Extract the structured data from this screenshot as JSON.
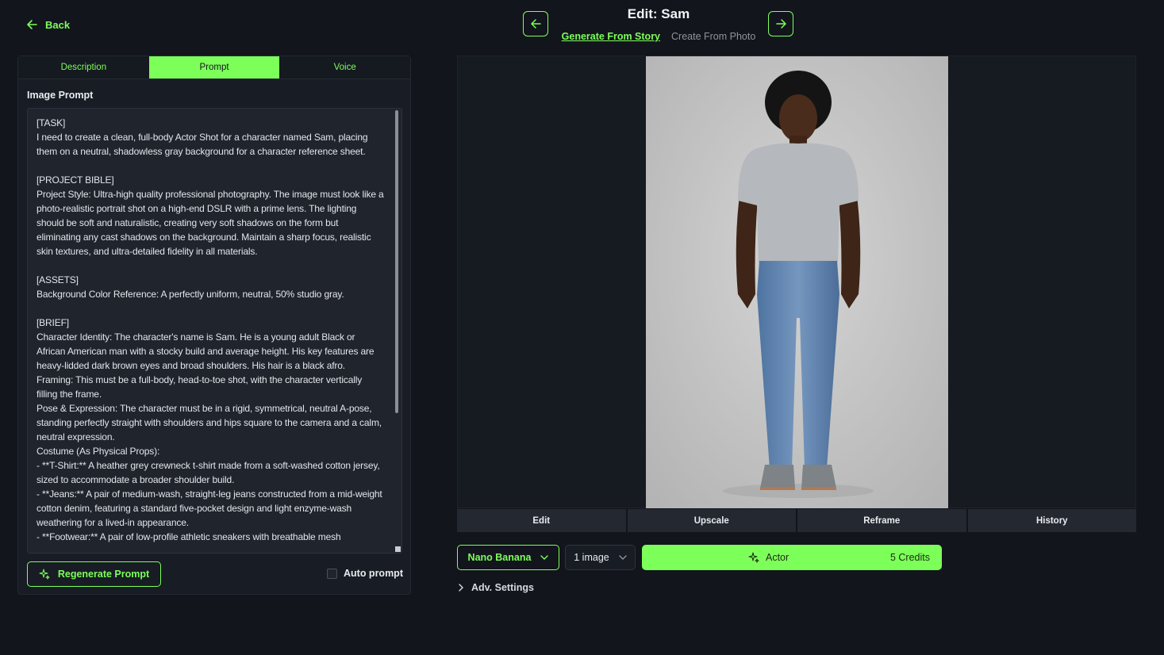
{
  "header": {
    "back_label": "Back",
    "title": "Edit: Sam",
    "mode_tabs": [
      {
        "label": "Generate From Story",
        "active": true
      },
      {
        "label": "Create From Photo",
        "active": false
      }
    ]
  },
  "left_panel": {
    "tabs": [
      {
        "label": "Description",
        "active": false
      },
      {
        "label": "Prompt",
        "active": true
      },
      {
        "label": "Voice",
        "active": false
      }
    ],
    "section_label": "Image Prompt",
    "prompt_text": "[TASK]\nI need to create a clean, full-body Actor Shot for a character named Sam, placing them on a neutral, shadowless gray background for a character reference sheet.\n\n[PROJECT BIBLE]\nProject Style: Ultra-high quality professional photography. The image must look like a photo-realistic portrait shot on a high-end DSLR with a prime lens. The lighting should be soft and naturalistic, creating very soft shadows on the form but eliminating any cast shadows on the background. Maintain a sharp focus, realistic skin textures, and ultra-detailed fidelity in all materials.\n\n[ASSETS]\nBackground Color Reference: A perfectly uniform, neutral, 50% studio gray.\n\n[BRIEF]\nCharacter Identity: The character's name is Sam. He is a young adult Black or African American man with a stocky build and average height. His key features are heavy-lidded dark brown eyes and broad shoulders. His hair is a black afro.\nFraming: This must be a full-body, head-to-toe shot, with the character vertically filling the frame.\nPose & Expression: The character must be in a rigid, symmetrical, neutral A-pose, standing perfectly straight with shoulders and hips square to the camera and a calm, neutral expression.\nCostume (As Physical Props):\n- **T-Shirt:** A heather grey crewneck t-shirt made from a soft-washed cotton jersey, sized to accommodate a broader shoulder build.\n- **Jeans:** A pair of medium-wash, straight-leg jeans constructed from a mid-weight cotton denim, featuring a standard five-pocket design and light enzyme-wash weathering for a lived-in appearance.\n- **Footwear:** A pair of low-profile athletic sneakers with breathable mesh",
    "regenerate_label": "Regenerate Prompt",
    "auto_prompt_label": "Auto prompt",
    "auto_prompt_checked": false
  },
  "actions": [
    "Edit",
    "Upscale",
    "Reframe",
    "History"
  ],
  "controls": {
    "model": "Nano Banana",
    "count": "1 image",
    "generate_label": "Actor",
    "credits": "5 Credits",
    "adv_settings": "Adv. Settings"
  },
  "colors": {
    "accent": "#7dff5a",
    "background": "#12151c",
    "panel": "#181c24"
  }
}
